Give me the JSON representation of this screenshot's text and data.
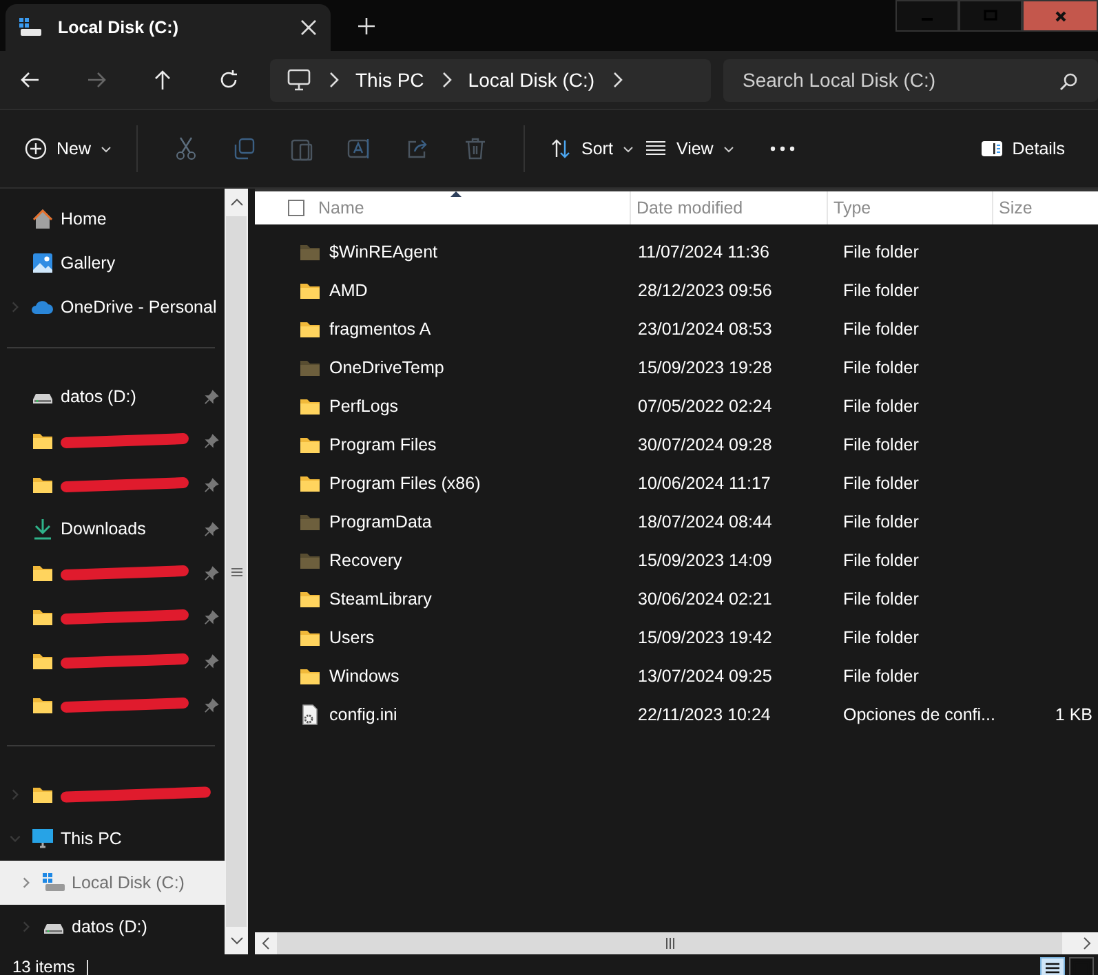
{
  "tab": {
    "title": "Local Disk (C:)"
  },
  "breadcrumb": [
    "This PC",
    "Local Disk (C:)"
  ],
  "search": {
    "placeholder": "Search Local Disk (C:)"
  },
  "toolbar": {
    "new": "New",
    "sort": "Sort",
    "view": "View",
    "details": "Details"
  },
  "sidebar": {
    "sections": [
      [
        {
          "kind": "home",
          "label": "Home",
          "expandable": false
        },
        {
          "kind": "gallery",
          "label": "Gallery",
          "expandable": false
        },
        {
          "kind": "onedrive",
          "label": "OneDrive - Personal",
          "expandable": true,
          "expanded": false
        }
      ],
      [
        {
          "kind": "drive",
          "label": "datos (D:)",
          "pinned": true
        },
        {
          "kind": "redacted",
          "pinned": true
        },
        {
          "kind": "redacted",
          "pinned": true
        },
        {
          "kind": "downloads",
          "label": "Downloads",
          "pinned": true
        },
        {
          "kind": "redacted",
          "pinned": true
        },
        {
          "kind": "redacted",
          "pinned": true
        },
        {
          "kind": "redacted",
          "pinned": true
        },
        {
          "kind": "redacted",
          "pinned": true
        }
      ],
      [
        {
          "kind": "redacted",
          "expandable": true,
          "expanded": false
        },
        {
          "kind": "pc",
          "label": "This PC",
          "expandable": true,
          "expanded": true,
          "children": [
            {
              "kind": "system-drive",
              "label": "Local Disk (C:)",
              "selected": true,
              "expandable": true,
              "expanded": false
            },
            {
              "kind": "drive",
              "label": "datos (D:)",
              "selected": false,
              "expandable": true,
              "expanded": false
            }
          ]
        }
      ]
    ]
  },
  "table": {
    "select_all": {
      "checked": false
    },
    "columns": [
      "Name",
      "Date modified",
      "Type",
      "Size"
    ],
    "rows": [
      {
        "kind": "folder",
        "hidden": true,
        "name": "$WinREAgent",
        "date": "11/07/2024 11:36",
        "type": "File folder"
      },
      {
        "kind": "folder",
        "hidden": false,
        "name": "AMD",
        "date": "28/12/2023 09:56",
        "type": "File folder"
      },
      {
        "kind": "folder",
        "hidden": false,
        "name": "fragmentos A",
        "date": "23/01/2024 08:53",
        "type": "File folder"
      },
      {
        "kind": "folder",
        "hidden": true,
        "name": "OneDriveTemp",
        "date": "15/09/2023 19:28",
        "type": "File folder"
      },
      {
        "kind": "folder",
        "hidden": false,
        "name": "PerfLogs",
        "date": "07/05/2022 02:24",
        "type": "File folder"
      },
      {
        "kind": "folder",
        "hidden": false,
        "name": "Program Files",
        "date": "30/07/2024 09:28",
        "type": "File folder"
      },
      {
        "kind": "folder",
        "hidden": false,
        "name": "Program Files (x86)",
        "date": "10/06/2024 11:17",
        "type": "File folder"
      },
      {
        "kind": "folder",
        "hidden": true,
        "name": "ProgramData",
        "date": "18/07/2024 08:44",
        "type": "File folder"
      },
      {
        "kind": "folder",
        "hidden": true,
        "name": "Recovery",
        "date": "15/09/2023 14:09",
        "type": "File folder"
      },
      {
        "kind": "folder",
        "hidden": false,
        "name": "SteamLibrary",
        "date": "30/06/2024 02:21",
        "type": "File folder"
      },
      {
        "kind": "folder",
        "hidden": false,
        "name": "Users",
        "date": "15/09/2023 19:42",
        "type": "File folder"
      },
      {
        "kind": "folder",
        "hidden": false,
        "name": "Windows",
        "date": "13/07/2024 09:25",
        "type": "File folder"
      },
      {
        "kind": "file",
        "hidden": false,
        "name": "config.ini",
        "date": "22/11/2023 10:24",
        "type": "Opciones de confi...",
        "size": "1 KB"
      }
    ]
  },
  "status_bar": {
    "count": "13 items",
    "views": [
      {
        "kind": "details",
        "selected": true
      },
      {
        "kind": "tiles",
        "selected": false
      }
    ]
  }
}
